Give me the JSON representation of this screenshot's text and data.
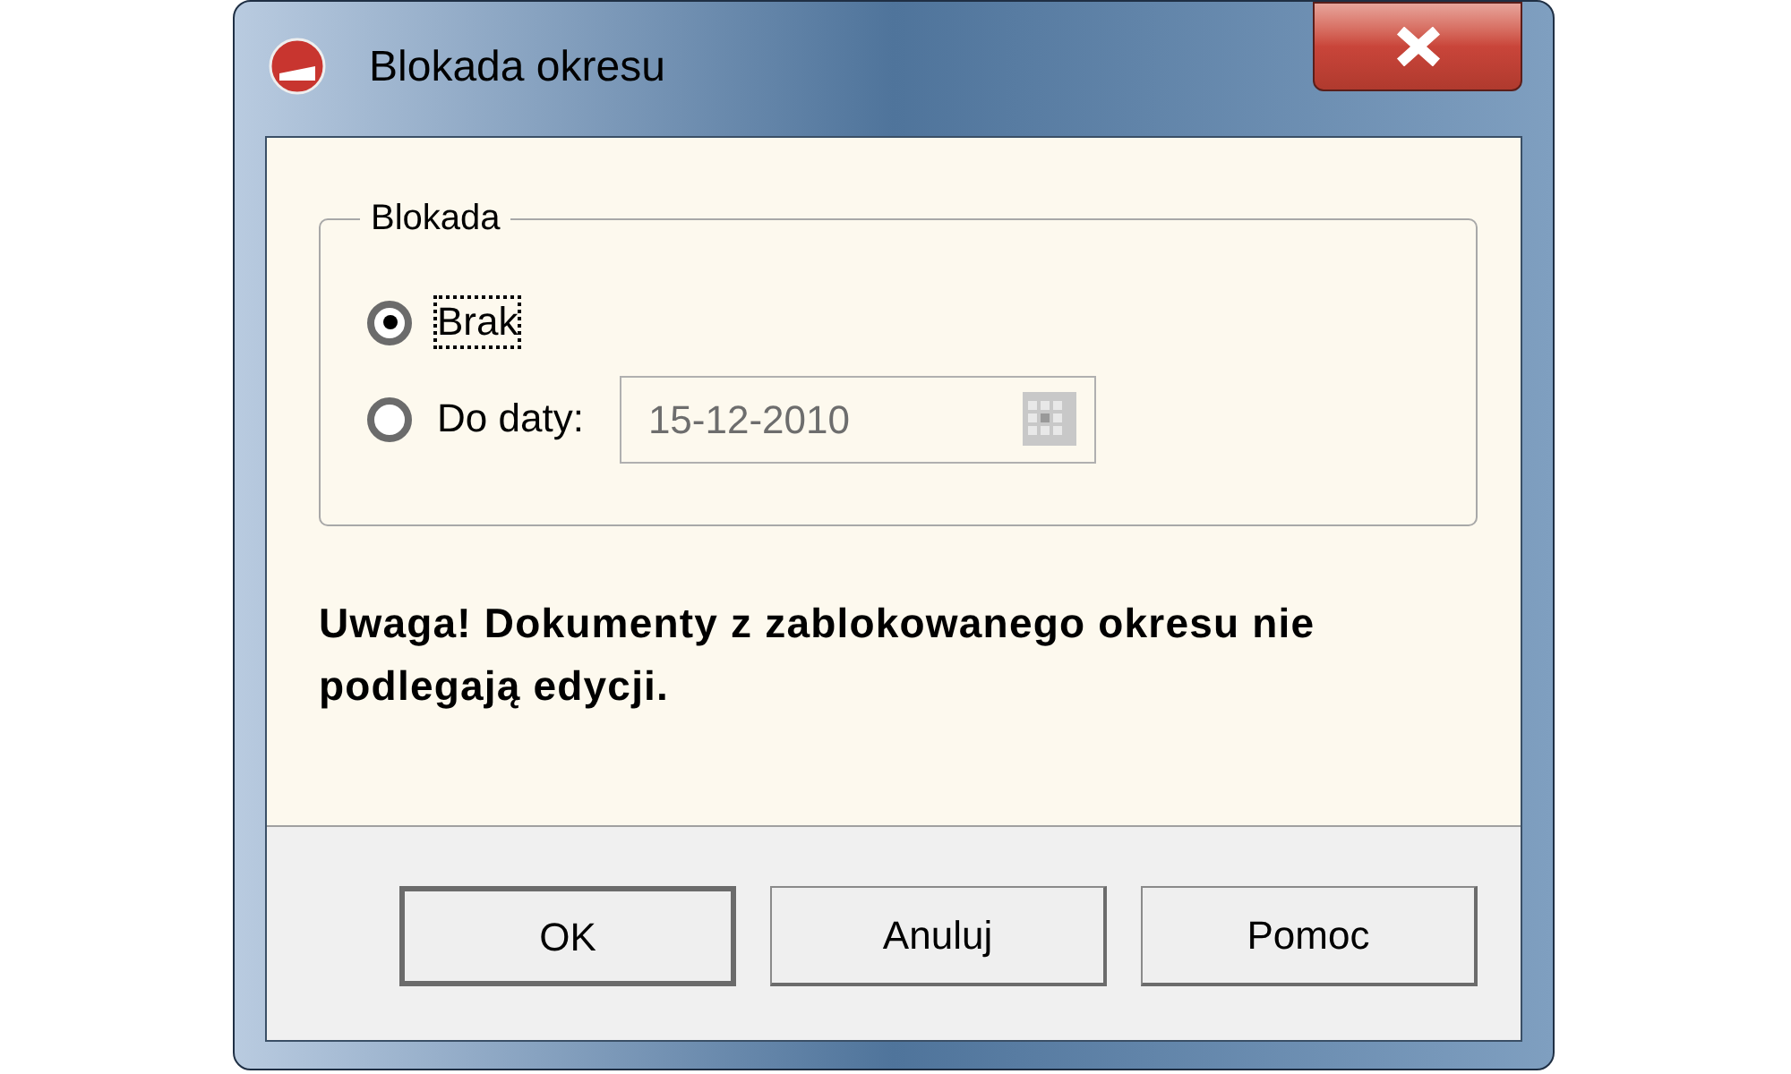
{
  "window": {
    "title": "Blokada okresu"
  },
  "group": {
    "legend": "Blokada",
    "options": [
      {
        "label": "Brak",
        "selected": true,
        "focused": true,
        "kind": "plain"
      },
      {
        "label": "Do daty:",
        "selected": false,
        "focused": false,
        "kind": "date"
      }
    ],
    "date_field": {
      "value": "15-12-2010",
      "disabled": true
    }
  },
  "warning": "Uwaga! Dokumenty z zablokowanego okresu nie podlegają edycji.",
  "buttons": [
    {
      "label": "OK",
      "default": true
    },
    {
      "label": "Anuluj",
      "default": false
    },
    {
      "label": "Pomoc",
      "default": false
    }
  ]
}
